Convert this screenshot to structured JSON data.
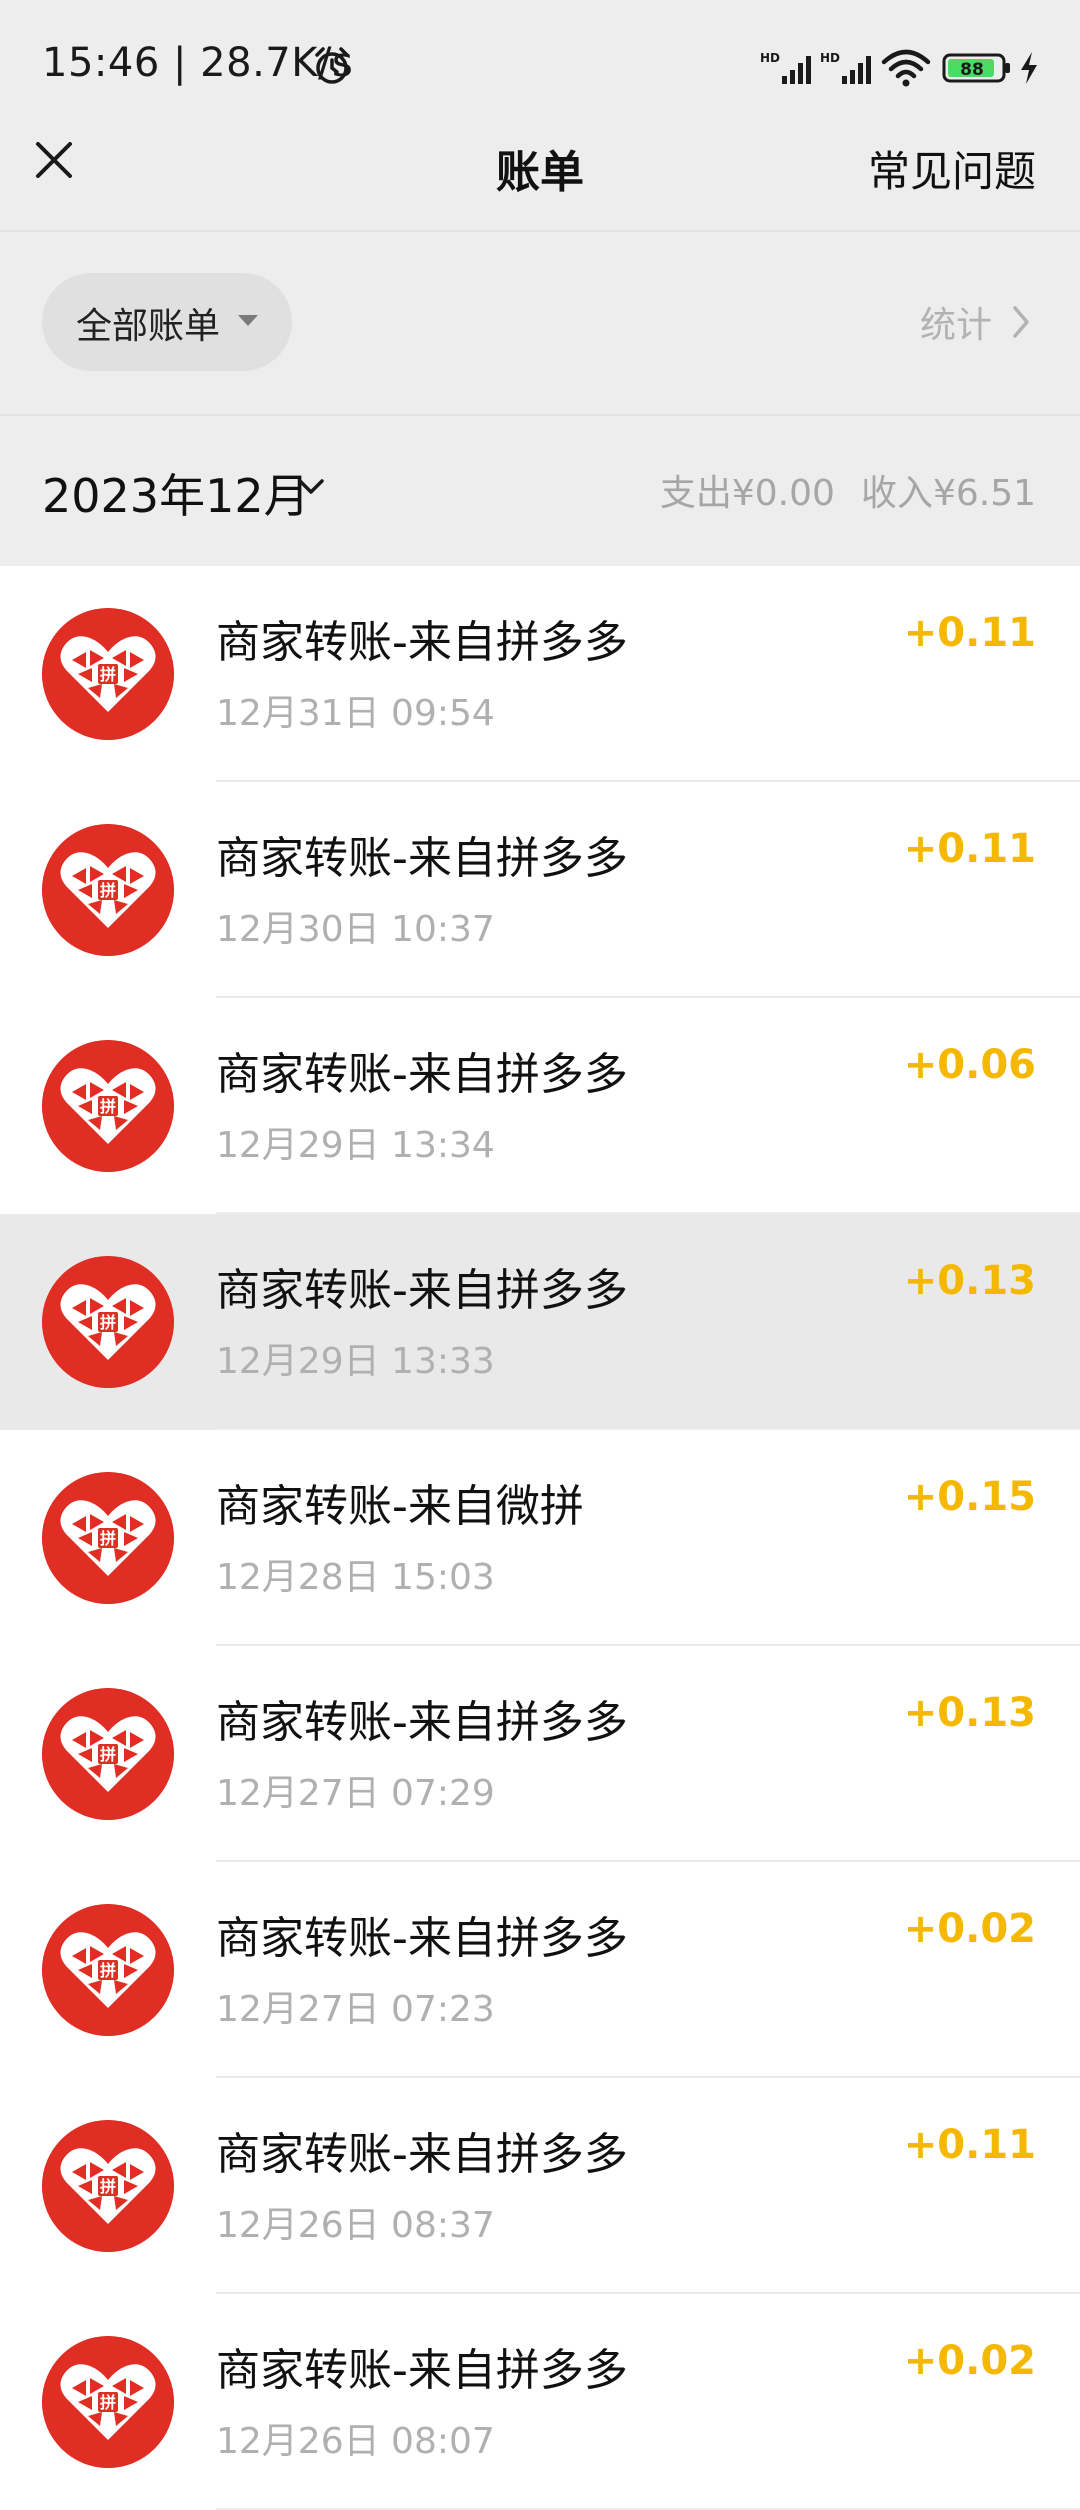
{
  "status_bar": {
    "time": "15:46 | 28.7K/s",
    "battery": "88",
    "network": "HD"
  },
  "nav": {
    "title": "账单",
    "faq": "常见问题"
  },
  "filter": {
    "label": "全部账单",
    "stats": "统计"
  },
  "month": {
    "label": "2023年12月",
    "expense": "支出¥0.00",
    "income": "收入¥6.51"
  },
  "colors": {
    "accent_income": "#f5b800",
    "brand_red": "#e02e24",
    "background": "#ededed"
  },
  "transactions": [
    {
      "title": "商家转账-来自拼多多",
      "time": "12月31日 09:54",
      "amount": "+0.11",
      "icon": "pinduoduo-logo-icon"
    },
    {
      "title": "商家转账-来自拼多多",
      "time": "12月30日 10:37",
      "amount": "+0.11",
      "icon": "pinduoduo-logo-icon"
    },
    {
      "title": "商家转账-来自拼多多",
      "time": "12月29日 13:34",
      "amount": "+0.06",
      "icon": "pinduoduo-logo-icon"
    },
    {
      "title": "商家转账-来自拼多多",
      "time": "12月29日 13:33",
      "amount": "+0.13",
      "icon": "pinduoduo-logo-icon",
      "highlighted": true
    },
    {
      "title": "商家转账-来自微拼",
      "time": "12月28日 15:03",
      "amount": "+0.15",
      "icon": "pinduoduo-logo-icon"
    },
    {
      "title": "商家转账-来自拼多多",
      "time": "12月27日 07:29",
      "amount": "+0.13",
      "icon": "pinduoduo-logo-icon"
    },
    {
      "title": "商家转账-来自拼多多",
      "time": "12月27日 07:23",
      "amount": "+0.02",
      "icon": "pinduoduo-logo-icon"
    },
    {
      "title": "商家转账-来自拼多多",
      "time": "12月26日 08:37",
      "amount": "+0.11",
      "icon": "pinduoduo-logo-icon"
    },
    {
      "title": "商家转账-来自拼多多",
      "time": "12月26日 08:07",
      "amount": "+0.02",
      "icon": "pinduoduo-logo-icon"
    }
  ]
}
